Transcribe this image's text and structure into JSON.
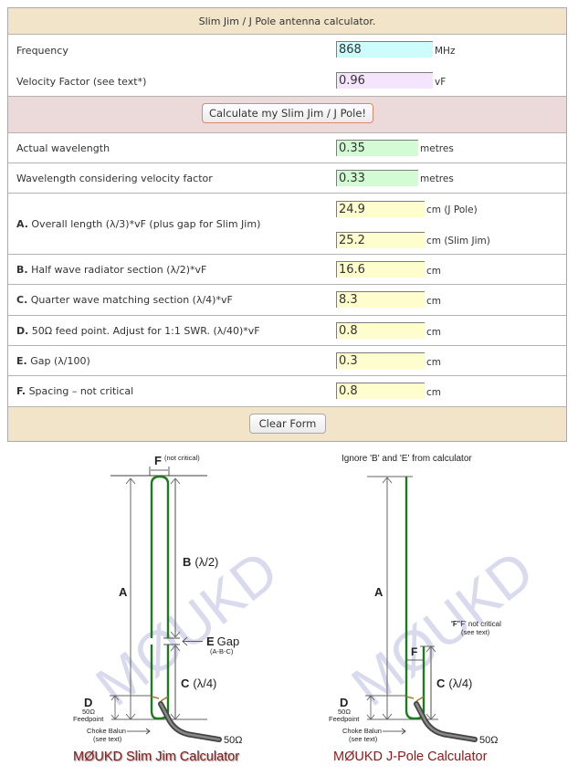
{
  "calculator": {
    "title": "Slim Jim / J Pole antenna calculator.",
    "inputs": {
      "frequency": {
        "label": "Frequency",
        "value": "868",
        "unit": "MHz",
        "color": "#cdfcfc"
      },
      "velocity_factor": {
        "label": "Velocity Factor (see text*)",
        "value": "0.96",
        "unit": "vF",
        "color": "#f4e4fc"
      }
    },
    "calculate_button": "Calculate my Slim Jim / J Pole!",
    "results": {
      "actual_wavelength": {
        "label": "Actual wavelength",
        "value": "0.35",
        "unit": "metres"
      },
      "wavelength_vf": {
        "label": "Wavelength considering velocity factor",
        "value": "0.33",
        "unit": "metres"
      },
      "a": {
        "letter": "A.",
        "label": " Overall length (λ/3)*vF (plus gap for Slim Jim)",
        "jpole_value": "24.9",
        "jpole_unit": "cm (J Pole)",
        "slimjim_value": "25.2",
        "slimjim_unit": "cm (Slim Jim)"
      },
      "b": {
        "letter": "B.",
        "label": " Half wave radiator section (λ/2)*vF",
        "value": "16.6",
        "unit": "cm"
      },
      "c": {
        "letter": "C.",
        "label": " Quarter wave matching section (λ/4)*vF",
        "value": "8.3",
        "unit": "cm"
      },
      "d": {
        "letter": "D.",
        "label": " 50Ω feed point. Adjust for 1:1 SWR. (λ/40)*vF",
        "value": "0.8",
        "unit": "cm"
      },
      "e": {
        "letter": "E.",
        "label": " Gap (λ/100)",
        "value": "0.3",
        "unit": "cm"
      },
      "f": {
        "letter": "F.",
        "label": " Spacing – not critical",
        "value": "0.8",
        "unit": "cm"
      }
    },
    "clear_button": "Clear Form",
    "colors": {
      "result_green": "#d4fcd4",
      "result_yellow": "#fdfdce",
      "header_bg": "#f2e4c9",
      "calc_bar_bg": "#ebdad9"
    }
  },
  "diagrams": {
    "slim_jim": {
      "f_label": "F",
      "f_note": "(not critical)",
      "a_label": "A",
      "b_label": "B",
      "b_formula": "(λ/2)",
      "e_label": "E",
      "e_gap": "Gap",
      "e_note": "(A-B-C)",
      "c_label": "C",
      "c_formula": "(λ/4)",
      "d_label": "D",
      "d_ohm": "50Ω",
      "d_note": "Feedpoint",
      "balun_1": "Choke Balun",
      "balun_2": "(see text)",
      "ohm": "50Ω",
      "watermark": "MØUKD",
      "caption": "MØUKD Slim Jim Calculator"
    },
    "j_pole": {
      "note": "Ignore 'B' and 'E' from calculator",
      "a_label": "A",
      "f_note_1": "'F' not critical",
      "f_note_2": "(see text)",
      "f_label": "F",
      "c_label": "C",
      "c_formula": "(λ/4)",
      "d_label": "D",
      "d_ohm": "50Ω",
      "d_note": "Feedpoint",
      "balun_1": "Choke Balun",
      "balun_2": "(see text)",
      "ohm": "50Ω",
      "watermark": "MØUKD",
      "caption": "MØUKD J-Pole Calculator"
    }
  }
}
